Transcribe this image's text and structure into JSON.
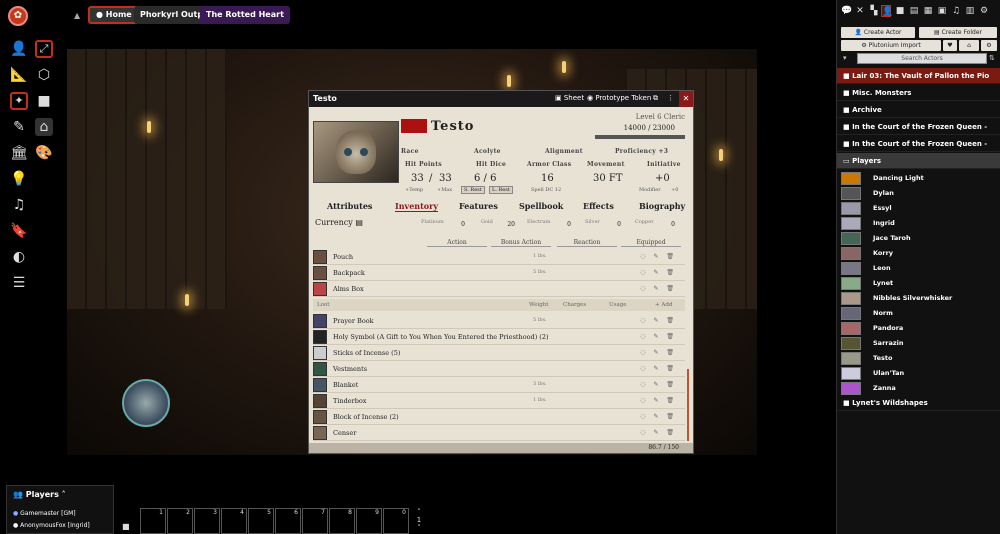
{
  "scene_nav": {
    "tabs": [
      {
        "label": "Home"
      },
      {
        "label": "Phorkyrl Outpost"
      },
      {
        "label": "The Rotted Heart"
      }
    ]
  },
  "sheet": {
    "window_title": "Testo",
    "header_buttons": {
      "sheet": "Sheet",
      "token": "Prototype Token"
    },
    "character_name": "Testo",
    "level_class": "Level 6 Cleric",
    "xp": "14000 / 23000",
    "race_label": "Race",
    "background": "Acolyte",
    "alignment_label": "Alignment",
    "proficiency": "Proficiency +3",
    "hit_points_label": "Hit Points",
    "hp_current": "33",
    "hp_sep": "/",
    "hp_max": "33",
    "hp_temp": "+Temp",
    "hp_maxmod": "+Max",
    "hit_dice_label": "Hit Dice",
    "hit_dice": "6 / 6",
    "s_rest": "S. Rest",
    "l_rest": "L. Rest",
    "ac_label": "Armor Class",
    "ac": "16",
    "spell_dc": "Spell DC 12",
    "movement_label": "Movement",
    "movement": "30 FT",
    "initiative_label": "Initiative",
    "initiative": "+0",
    "modifier": "Modifier",
    "modifier_val": "+0",
    "tabs": [
      "Attributes",
      "Inventory",
      "Features",
      "Spellbook",
      "Effects",
      "Biography"
    ],
    "currency": {
      "label": "Currency",
      "coins": [
        {
          "name": "Platinum",
          "value": "0"
        },
        {
          "name": "Gold",
          "value": "20"
        },
        {
          "name": "Electrum",
          "value": "0"
        },
        {
          "name": "Silver",
          "value": "0"
        },
        {
          "name": "Copper",
          "value": "0"
        }
      ]
    },
    "equip_columns": [
      "Action",
      "Bonus Action",
      "Reaction",
      "Equipped"
    ],
    "containers": [
      {
        "name": "Pouch",
        "weight": "1 lbs."
      },
      {
        "name": "Backpack",
        "weight": "5 lbs."
      },
      {
        "name": "Alms Box",
        "weight": ""
      }
    ],
    "loot_header": {
      "label": "Loot",
      "weight": "Weight",
      "charges": "Charges",
      "usage": "Usage",
      "add": "+ Add"
    },
    "loot": [
      {
        "name": "Prayer Book",
        "weight": "5 lbs."
      },
      {
        "name": "Holy Symbol (A Gift to You When You Entered the Priesthood) (2)",
        "weight": ""
      },
      {
        "name": "Sticks of Incense (5)",
        "weight": ""
      },
      {
        "name": "Vestments",
        "weight": ""
      },
      {
        "name": "Blanket",
        "weight": "3 lbs."
      },
      {
        "name": "Tinderbox",
        "weight": "1 lbs."
      },
      {
        "name": "Block of Incense (2)",
        "weight": ""
      },
      {
        "name": "Censer",
        "weight": ""
      }
    ],
    "footer_weight": "86.7 / 150"
  },
  "sidebar": {
    "create_actor": "Create Actor",
    "create_folder": "Create Folder",
    "plutonium_import": "Plutonium Import",
    "search_placeholder": "Search Actors",
    "folders_top": [
      {
        "name": "Lair 03: The Vault of Pallon the Pio"
      },
      {
        "name": "Misc. Monsters"
      },
      {
        "name": "Archive"
      },
      {
        "name": "In the Court of the Frozen Queen -"
      },
      {
        "name": "In the Court of the Frozen Queen -"
      }
    ],
    "players_folder": "Players",
    "actors": [
      "Dancing Light",
      "Dylan",
      "Essyl",
      "Ingrid",
      "Jace Taroh",
      "Korry",
      "Leon",
      "Lynet",
      "Nibbles Silverwhisker",
      "Norm",
      "Pandora",
      "Sarrazin",
      "Testo",
      "Ulan'Tan",
      "Zanna"
    ],
    "last_folder": "Lynet's Wildshapes",
    "colors": {
      "accent": "#c0301a",
      "folder_red": "#7a1a10"
    }
  },
  "players": {
    "title": "Players",
    "list": [
      {
        "name": "Gamemaster [GM]"
      },
      {
        "name": "AnonymousFox [Ingrid]"
      }
    ]
  },
  "hotbar": {
    "slots": [
      "1",
      "2",
      "3",
      "4",
      "5",
      "6",
      "7",
      "8",
      "9",
      "0"
    ],
    "page": "1"
  }
}
